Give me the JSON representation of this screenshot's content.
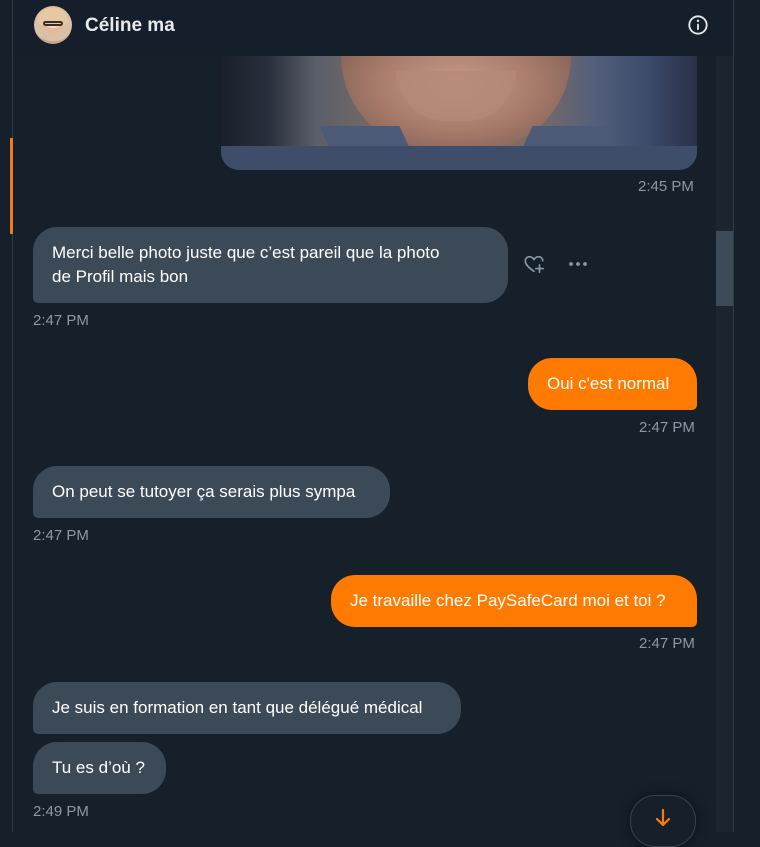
{
  "header": {
    "contact_name": "Céline ma"
  },
  "icons": {
    "info": "info-icon",
    "react": "heart-plus-icon",
    "more": "more-icon",
    "scroll": "arrow-down-icon"
  },
  "colors": {
    "outgoing": "#ff7a00",
    "incoming": "#3c4a57",
    "background": "#15202b",
    "accent": "#f07b1d"
  },
  "messages": [
    {
      "direction": "out",
      "kind": "image",
      "time": "2:45 PM"
    },
    {
      "direction": "in",
      "lines": [
        "Merci belle photo juste que c’est pareil que la photo",
        "de Profil mais  bon"
      ],
      "time": "2:47 PM"
    },
    {
      "direction": "out",
      "text": "Oui c'est normal",
      "time": "2:47 PM"
    },
    {
      "direction": "in",
      "text": "On peut se tutoyer ça serais plus sympa",
      "time": "2:47 PM"
    },
    {
      "direction": "out",
      "text": "Je travaille chez PaySafeCard moi et toi ?",
      "time": "2:47 PM"
    },
    {
      "direction": "in",
      "text": "Je suis en formation en tant que délégué médical"
    },
    {
      "direction": "in",
      "text": "Tu es d’où ?",
      "time": "2:49 PM"
    }
  ]
}
